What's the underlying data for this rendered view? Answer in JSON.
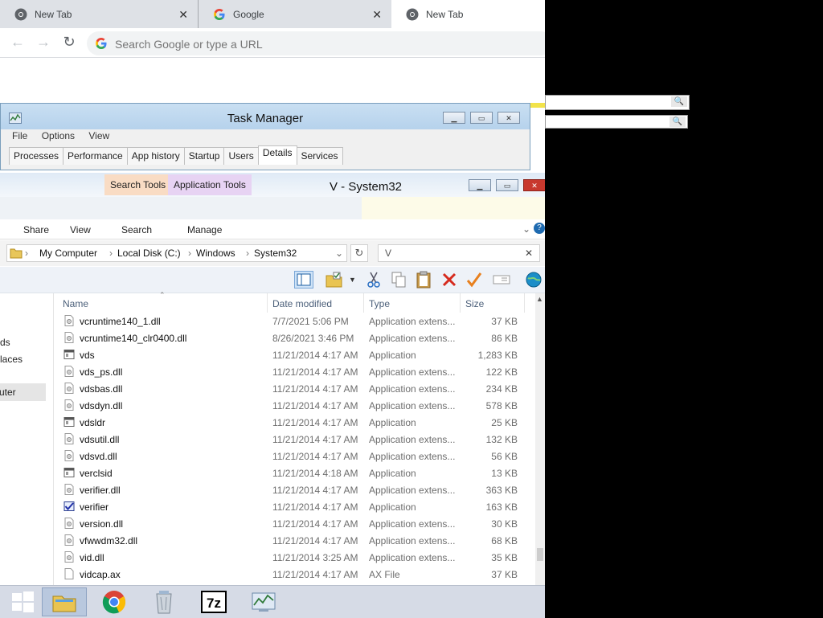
{
  "chrome": {
    "tabs": [
      {
        "title": "New Tab",
        "icon": "chrome-icon",
        "active": false
      },
      {
        "title": "Google",
        "icon": "google-icon",
        "active": false
      },
      {
        "title": "New Tab",
        "icon": "chrome-icon",
        "active": true
      }
    ],
    "omnibox_placeholder": "Search Google or type a URL"
  },
  "task_manager": {
    "title": "Task Manager",
    "menu": [
      "File",
      "Options",
      "View"
    ],
    "tabs": [
      "Processes",
      "Performance",
      "App history",
      "Startup",
      "Users",
      "Details",
      "Services"
    ],
    "selected_tab": "Details"
  },
  "explorer": {
    "context_tabs": [
      "Search Tools",
      "Application Tools"
    ],
    "title": "V - System32",
    "ribbon_tabs": [
      "Share",
      "View",
      "Search",
      "Manage"
    ],
    "breadcrumb": [
      "My Computer",
      "Local Disk (C:)",
      "Windows",
      "System32"
    ],
    "search_value": "V",
    "nav_items": [
      "ds",
      "laces",
      "uter"
    ],
    "columns": [
      "Name",
      "Date modified",
      "Type",
      "Size"
    ],
    "files": [
      {
        "name": "vcruntime140_1.dll",
        "date": "7/7/2021 5:06 PM",
        "type": "Application extens...",
        "size": "37 KB",
        "icon": "dll-file-icon"
      },
      {
        "name": "vcruntime140_clr0400.dll",
        "date": "8/26/2021 3:46 PM",
        "type": "Application extens...",
        "size": "86 KB",
        "icon": "dll-file-icon"
      },
      {
        "name": "vds",
        "date": "11/21/2014 4:17 AM",
        "type": "Application",
        "size": "1,283 KB",
        "icon": "application-icon"
      },
      {
        "name": "vds_ps.dll",
        "date": "11/21/2014 4:17 AM",
        "type": "Application extens...",
        "size": "122 KB",
        "icon": "dll-file-icon"
      },
      {
        "name": "vdsbas.dll",
        "date": "11/21/2014 4:17 AM",
        "type": "Application extens...",
        "size": "234 KB",
        "icon": "dll-file-icon"
      },
      {
        "name": "vdsdyn.dll",
        "date": "11/21/2014 4:17 AM",
        "type": "Application extens...",
        "size": "578 KB",
        "icon": "dll-file-icon"
      },
      {
        "name": "vdsldr",
        "date": "11/21/2014 4:17 AM",
        "type": "Application",
        "size": "25 KB",
        "icon": "application-icon"
      },
      {
        "name": "vdsutil.dll",
        "date": "11/21/2014 4:17 AM",
        "type": "Application extens...",
        "size": "132 KB",
        "icon": "dll-file-icon"
      },
      {
        "name": "vdsvd.dll",
        "date": "11/21/2014 4:17 AM",
        "type": "Application extens...",
        "size": "56 KB",
        "icon": "dll-file-icon"
      },
      {
        "name": "verclsid",
        "date": "11/21/2014 4:18 AM",
        "type": "Application",
        "size": "13 KB",
        "icon": "application-icon"
      },
      {
        "name": "verifier.dll",
        "date": "11/21/2014 4:17 AM",
        "type": "Application extens...",
        "size": "363 KB",
        "icon": "dll-file-icon"
      },
      {
        "name": "verifier",
        "date": "11/21/2014 4:17 AM",
        "type": "Application",
        "size": "163 KB",
        "icon": "verifier-app-icon"
      },
      {
        "name": "version.dll",
        "date": "11/21/2014 4:17 AM",
        "type": "Application extens...",
        "size": "30 KB",
        "icon": "dll-file-icon"
      },
      {
        "name": "vfwwdm32.dll",
        "date": "11/21/2014 4:17 AM",
        "type": "Application extens...",
        "size": "68 KB",
        "icon": "dll-file-icon"
      },
      {
        "name": "vid.dll",
        "date": "11/21/2014 3:25 AM",
        "type": "Application extens...",
        "size": "35 KB",
        "icon": "dll-file-icon"
      },
      {
        "name": "vidcap.ax",
        "date": "11/21/2014 4:17 AM",
        "type": "AX File",
        "size": "37 KB",
        "icon": "blank-file-icon"
      }
    ]
  },
  "taskbar": {
    "items": [
      "start-icon",
      "file-explorer-icon",
      "chrome-icon",
      "recycle-bin-icon",
      "7zip-icon",
      "task-manager-icon"
    ]
  },
  "colors": {
    "search_tools_tab": "#f9dcc4",
    "application_tools_tab": "#e7d3f3",
    "taskbar": "#d6dbe6"
  }
}
